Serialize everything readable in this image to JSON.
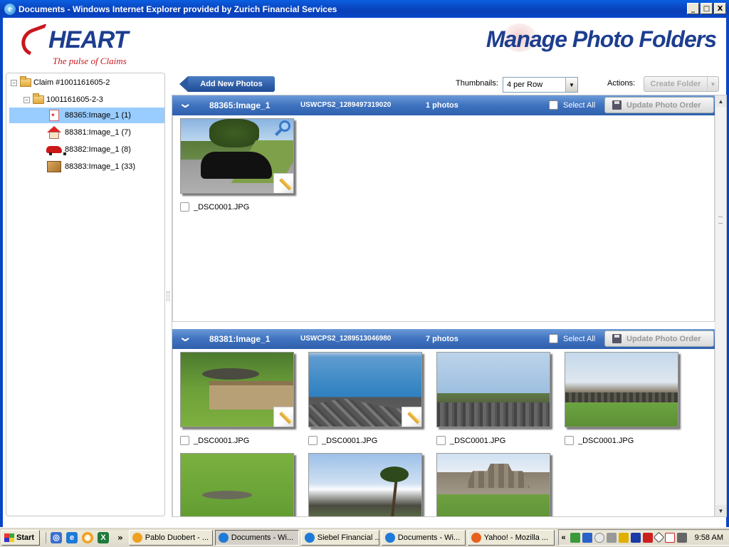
{
  "window": {
    "title": "Documents - Windows Internet Explorer provided by Zurich Financial Services",
    "min": "_",
    "max": "□",
    "close": "X"
  },
  "header": {
    "brand": "HEART",
    "tagline": "The pulse of Claims",
    "page_title": "Manage Photo Folders"
  },
  "tree": {
    "items": [
      {
        "label": "Claim #1001161605-2",
        "toggle": "−",
        "icon": "folder-icon"
      },
      {
        "label": "1001161605-2-3",
        "toggle": "−",
        "icon": "folder-icon"
      },
      {
        "label": "88365:Image_1 (1)",
        "icon": "medical-document-icon",
        "selected": true
      },
      {
        "label": "88381:Image_1 (7)",
        "icon": "house-icon"
      },
      {
        "label": "88382:Image_1 (8)",
        "icon": "car-icon"
      },
      {
        "label": "88383:Image_1 (33)",
        "icon": "box-icon"
      }
    ]
  },
  "toolbar": {
    "add_photos": "Add New Photos",
    "thumbnails_label": "Thumbnails:",
    "thumbnails_value": "4 per Row",
    "actions_label": "Actions:",
    "create_folder": "Create Folder"
  },
  "folders": [
    {
      "name": "88365:Image_1",
      "id": "USWCPS2_1289497319020",
      "count": "1 photos",
      "select_all": "Select All",
      "update_order": "Update Photo Order",
      "photos": [
        {
          "filename": "_DSC0001.JPG",
          "scene": "car",
          "edit_icon": true,
          "zoom_icon": true
        }
      ]
    },
    {
      "name": "88381:Image_1",
      "id": "USWCPS2_1289513046980",
      "count": "7 photos",
      "select_all": "Select All",
      "update_order": "Update Photo Order",
      "photos": [
        {
          "filename": "_DSC0001.JPG",
          "scene": "iguana",
          "edit_icon": true
        },
        {
          "filename": "_DSC0001.JPG",
          "scene": "sea",
          "edit_icon": true
        },
        {
          "filename": "_DSC0001.JPG",
          "scene": "coast"
        },
        {
          "filename": "_DSC0001.JPG",
          "scene": "field"
        },
        {
          "scene": "lawn"
        },
        {
          "scene": "palm"
        },
        {
          "scene": "ruins"
        }
      ]
    }
  ],
  "taskbar": {
    "start": "Start",
    "tasks": [
      {
        "label": "Pablo Duobert - ...",
        "icon_color": "#f0a020"
      },
      {
        "label": "Documents - Wi...",
        "icon_color": "#1e7ad8",
        "active": true
      },
      {
        "label": "Siebel Financial ...",
        "icon_color": "#1e7ad8"
      },
      {
        "label": "Documents - Wi...",
        "icon_color": "#1e7ad8"
      },
      {
        "label": "Yahoo! - Mozilla ...",
        "icon_color": "#e8601c"
      }
    ],
    "chevron": "«",
    "clock": "9:58 AM"
  }
}
